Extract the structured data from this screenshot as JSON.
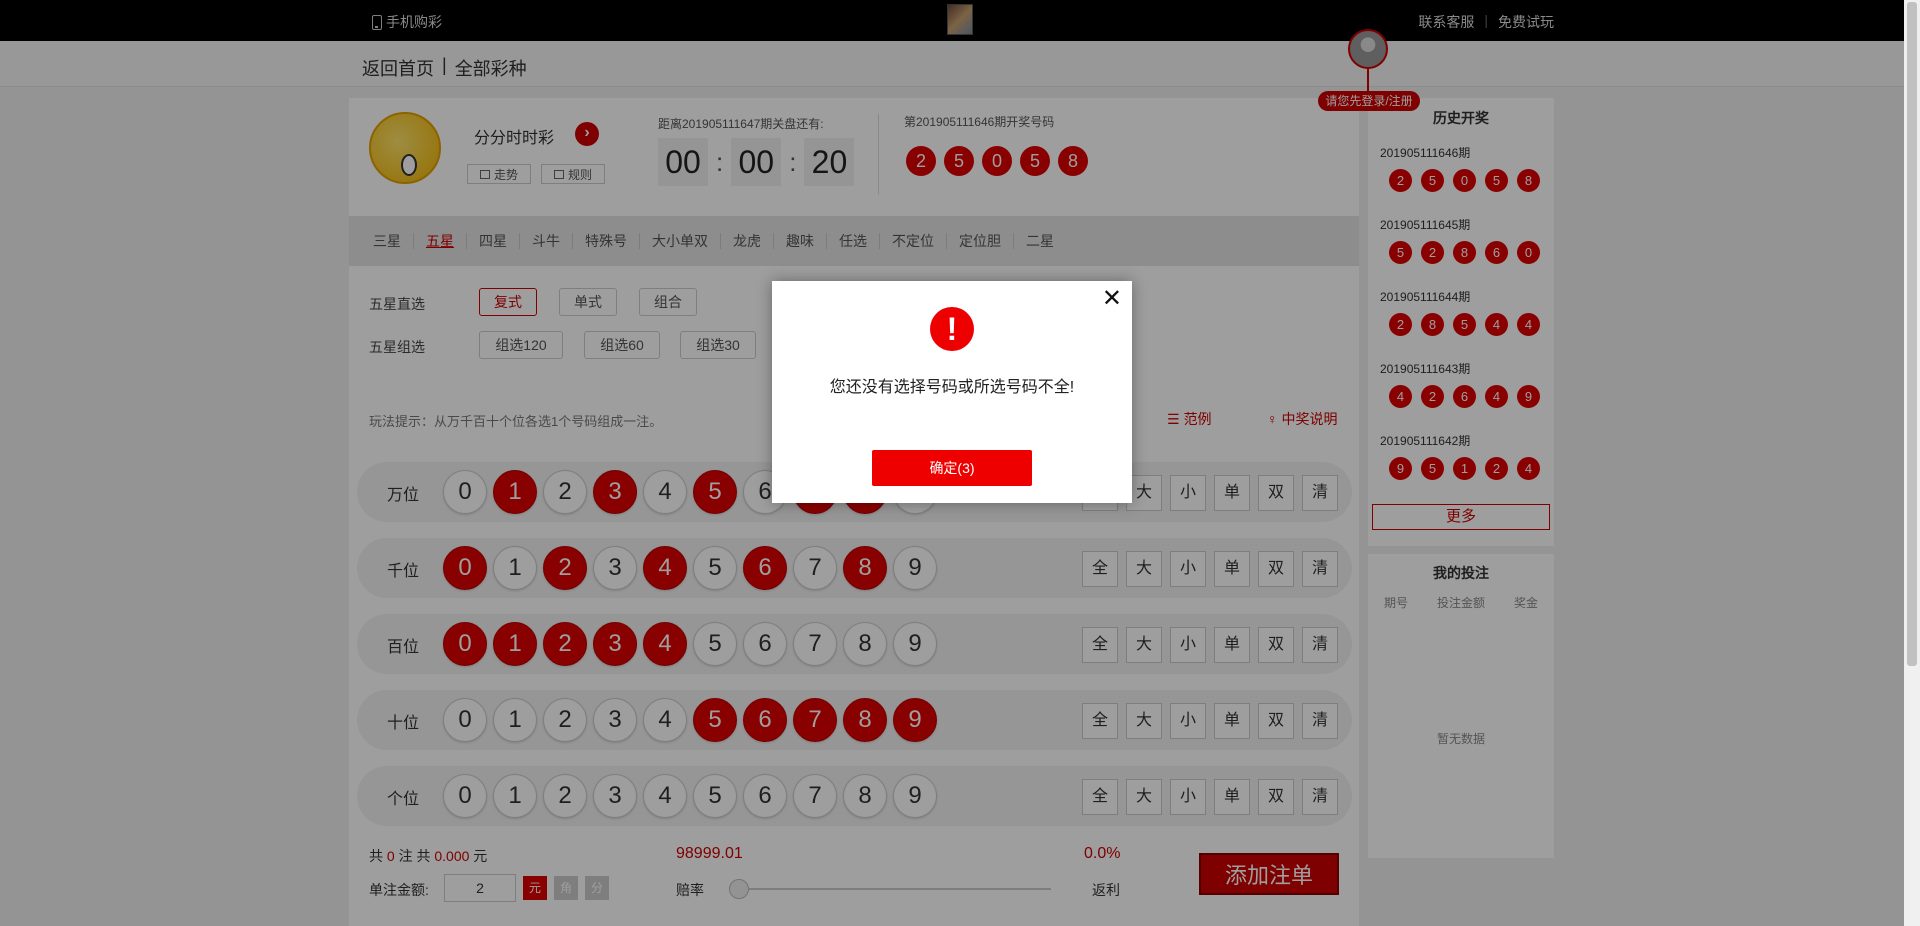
{
  "topbar": {
    "mobile_label": "手机购彩",
    "contact": "联系客服",
    "sep": "|",
    "trial": "免费试玩"
  },
  "nav": {
    "home": "返回首页",
    "sep": "|",
    "all": "全部彩种"
  },
  "user": {
    "login_hint": "请您先登录/注册"
  },
  "game": {
    "name": "分分时时彩",
    "trend_label": "走势",
    "rules_label": "规则",
    "countdown_label": "距离201905111647期关盘还有:",
    "countdown": {
      "h": "00",
      "m": "00",
      "s": "20"
    },
    "open_label": "第201905111646期开奖号码",
    "open_numbers": [
      "2",
      "5",
      "0",
      "5",
      "8"
    ]
  },
  "tabs": [
    "三星",
    "五星",
    "四星",
    "斗牛",
    "特殊号",
    "大小单双",
    "龙虎",
    "趣味",
    "任选",
    "不定位",
    "定位胆",
    "二星"
  ],
  "active_tab": "五星",
  "sub": {
    "direct_label": "五星直选",
    "direct_opts": [
      "复式",
      "单式",
      "组合"
    ],
    "group_label": "五星组选",
    "group_opts": [
      "组选120",
      "组选60",
      "组选30"
    ]
  },
  "hint": "玩法提示：从万千百十个位各选1个号码组成一注。",
  "example_label": "范例",
  "win_label": "中奖说明",
  "rows": [
    {
      "label": "万位",
      "selected": [
        1,
        3,
        5,
        7,
        8
      ]
    },
    {
      "label": "千位",
      "selected": [
        0,
        2,
        4,
        6,
        8
      ]
    },
    {
      "label": "百位",
      "selected": [
        0,
        1,
        2,
        3,
        4
      ]
    },
    {
      "label": "十位",
      "selected": [
        5,
        6,
        7,
        8,
        9
      ]
    },
    {
      "label": "个位",
      "selected": []
    }
  ],
  "digits": [
    "0",
    "1",
    "2",
    "3",
    "4",
    "5",
    "6",
    "7",
    "8",
    "9"
  ],
  "quick": [
    "全",
    "大",
    "小",
    "单",
    "双",
    "清"
  ],
  "footer": {
    "pre": "共",
    "count": "0",
    "mid": "注 共",
    "amount": "0.000",
    "unit": "元",
    "unit_amount_label": "单注金额:",
    "unit_amount": "2",
    "units": [
      "元",
      "角",
      "分"
    ],
    "odds": "98999.01",
    "odds_label": "赔率",
    "rebate": "0.0%",
    "rebate_label": "返利",
    "add_btn": "添加注单"
  },
  "history": {
    "title": "历史开奖",
    "items": [
      {
        "period": "201905111646期",
        "nums": [
          "2",
          "5",
          "0",
          "5",
          "8"
        ]
      },
      {
        "period": "201905111645期",
        "nums": [
          "5",
          "2",
          "8",
          "6",
          "0"
        ]
      },
      {
        "period": "201905111644期",
        "nums": [
          "2",
          "8",
          "5",
          "4",
          "4"
        ]
      },
      {
        "period": "201905111643期",
        "nums": [
          "4",
          "2",
          "6",
          "4",
          "9"
        ]
      },
      {
        "period": "201905111642期",
        "nums": [
          "9",
          "5",
          "1",
          "2",
          "4"
        ]
      }
    ],
    "more": "更多"
  },
  "mybets": {
    "title": "我的投注",
    "headers": [
      "期号",
      "投注金额",
      "奖金"
    ],
    "empty": "暂无数据"
  },
  "modal": {
    "close": "✕",
    "message": "您还没有选择号码或所选号码不全!",
    "ok": "确定(3)"
  },
  "colors": {
    "accent": "#d00000",
    "overlay": "rgba(0,0,0,0.38)"
  }
}
